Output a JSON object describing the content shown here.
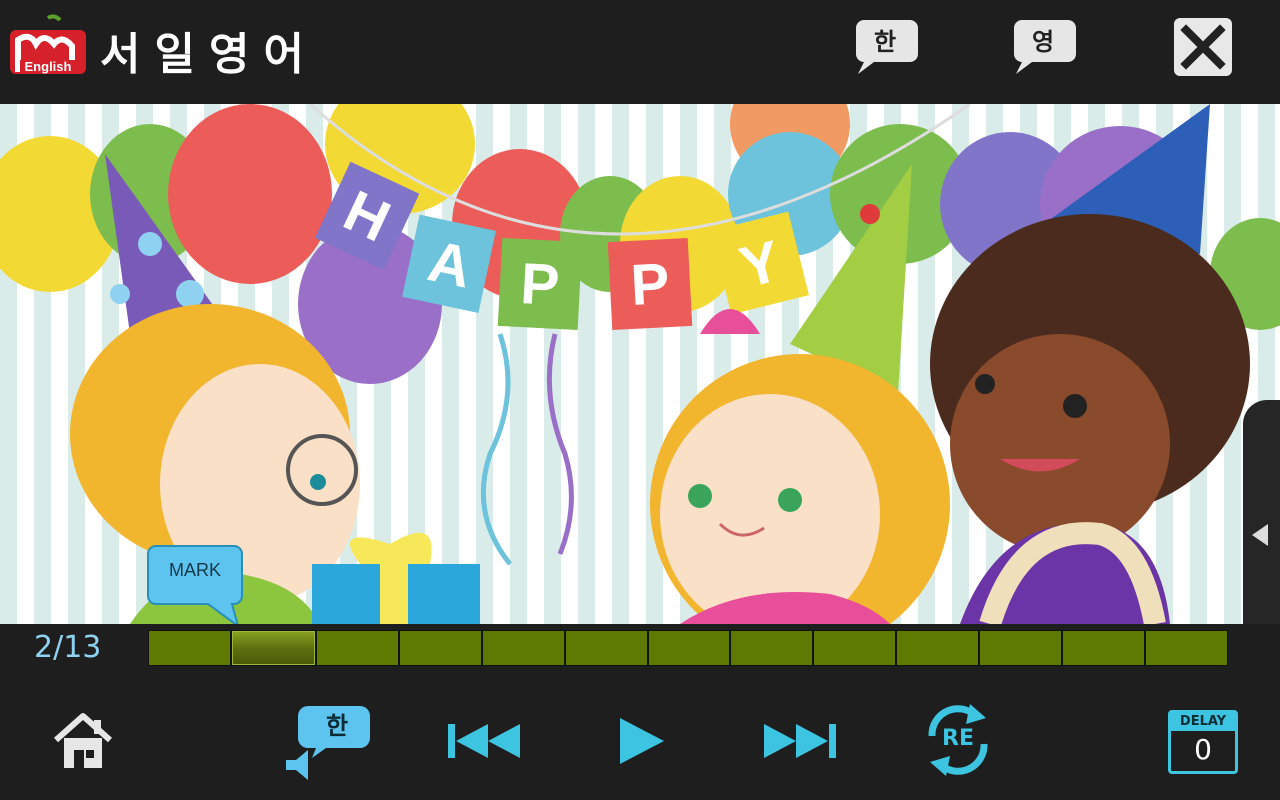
{
  "header": {
    "logo_text": "English",
    "title": "서일영어",
    "lang_korean": "한",
    "lang_english": "영"
  },
  "scene": {
    "banner_letters": [
      "H",
      "A",
      "P",
      "P",
      "Y"
    ],
    "speaker_label": "MARK"
  },
  "progress": {
    "counter": "2/13",
    "current": 2,
    "total": 13
  },
  "controls": {
    "subtitle_lang": "한",
    "replay_label": "RE",
    "delay_label": "DELAY",
    "delay_value": "0"
  },
  "icons": [
    "home-icon",
    "speech-korean-icon",
    "skip-back-icon",
    "play-icon",
    "skip-forward-icon",
    "replay-icon",
    "close-icon",
    "chevron-left-icon"
  ],
  "colors": {
    "accent_cyan": "#3cc4e0",
    "progress_green": "#5f7a00",
    "logo_red": "#d6202a",
    "background": "#1e1e1e"
  }
}
